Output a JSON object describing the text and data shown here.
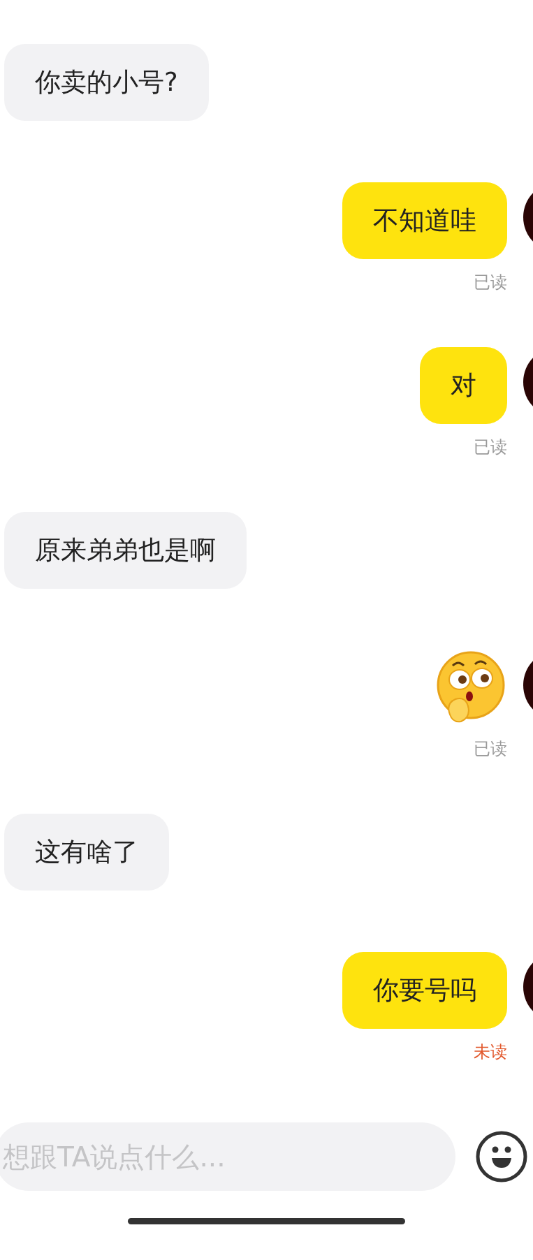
{
  "messages": [
    {
      "mine": false,
      "kind": "text",
      "text": "你卖的小号?"
    },
    {
      "mine": true,
      "kind": "text",
      "text": "不知道哇",
      "status": {
        "text": "已读",
        "read": true
      }
    },
    {
      "mine": true,
      "kind": "text",
      "text": "对",
      "status": {
        "text": "已读",
        "read": true
      }
    },
    {
      "mine": false,
      "kind": "text",
      "text": "原来弟弟也是啊"
    },
    {
      "mine": true,
      "kind": "sticker",
      "status": {
        "text": "已读",
        "read": true
      }
    },
    {
      "mine": false,
      "kind": "text",
      "text": "这有啥了"
    },
    {
      "mine": true,
      "kind": "text",
      "text": "你要号吗",
      "status": {
        "text": "未读",
        "read": false
      }
    }
  ],
  "composer": {
    "placeholder": "想跟TA说点什么..."
  }
}
